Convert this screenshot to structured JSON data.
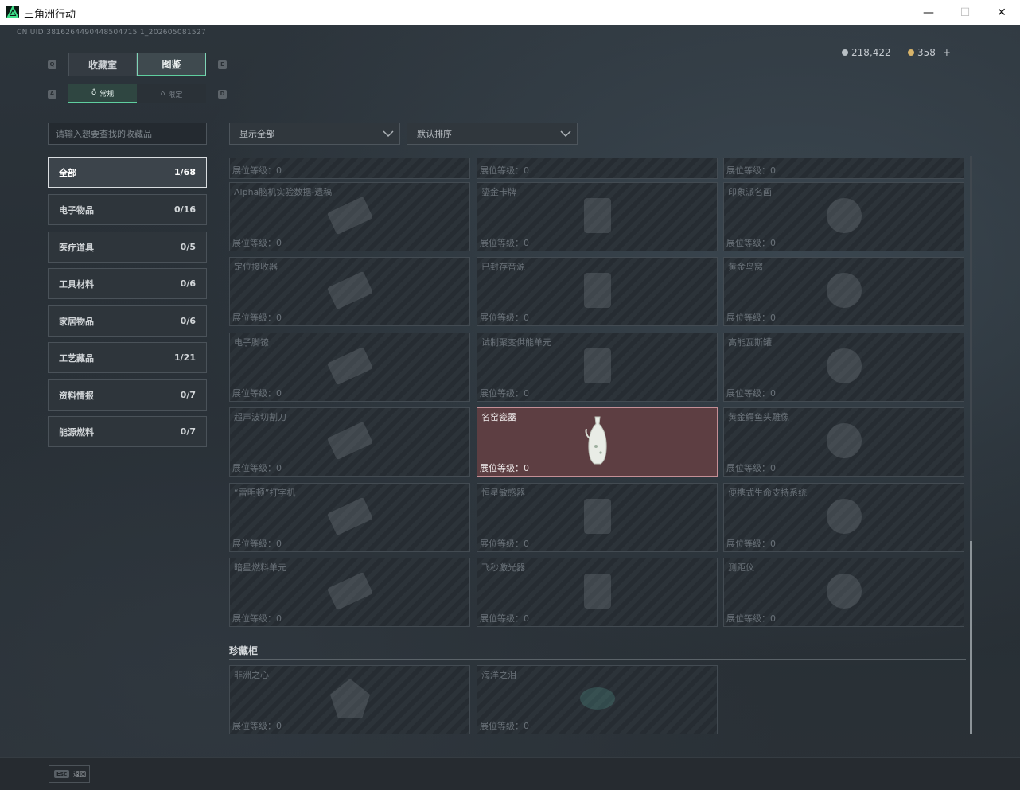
{
  "window": {
    "title": "三角洲行动"
  },
  "uid_text": "CN UID:3816264490448504715 1_202605081527",
  "currency": {
    "coins": "218,422",
    "gems": "358",
    "add_symbol": "+"
  },
  "keys": {
    "tab_left": "Q",
    "tab_right": "E",
    "subtab_left": "A",
    "subtab_right": "D"
  },
  "tabs": {
    "collection": "收藏室",
    "atlas": "图鉴"
  },
  "subtabs": {
    "regular": "常规",
    "limited": "限定"
  },
  "search": {
    "placeholder": "请输入想要查找的收藏品"
  },
  "dropdowns": {
    "filter": "显示全部",
    "sort": "默认排序"
  },
  "categories": [
    {
      "label": "全部",
      "count": "1/68"
    },
    {
      "label": "电子物品",
      "count": "0/16"
    },
    {
      "label": "医疗道具",
      "count": "0/5"
    },
    {
      "label": "工具材料",
      "count": "0/6"
    },
    {
      "label": "家居物品",
      "count": "0/6"
    },
    {
      "label": "工艺藏品",
      "count": "1/21"
    },
    {
      "label": "资料情报",
      "count": "0/7"
    },
    {
      "label": "能源燃料",
      "count": "0/7"
    }
  ],
  "level_label": "展位等级：0",
  "items": [
    {
      "name": ""
    },
    {
      "name": ""
    },
    {
      "name": ""
    },
    {
      "name": "Alpha脑机实验数据-遗稿"
    },
    {
      "name": "鎏金卡牌"
    },
    {
      "name": "印象派名画"
    },
    {
      "name": "定位接收器"
    },
    {
      "name": "已封存音源"
    },
    {
      "name": "黄金鸟窝"
    },
    {
      "name": "电子脚镣"
    },
    {
      "name": "试制聚变供能单元"
    },
    {
      "name": "高能瓦斯罐"
    },
    {
      "name": "超声波切割刀"
    },
    {
      "name": "名窑瓷器"
    },
    {
      "name": "黄金鳄鱼头雕像"
    },
    {
      "name": "“雷明顿”打字机"
    },
    {
      "name": "恒星敏感器"
    },
    {
      "name": "便携式生命支持系统"
    },
    {
      "name": "暗星燃料单元"
    },
    {
      "name": "飞秒激光器"
    },
    {
      "name": "测距仪"
    }
  ],
  "section": {
    "title": "珍藏柜"
  },
  "cabinet_items": [
    {
      "name": "非洲之心"
    },
    {
      "name": "海洋之泪"
    }
  ],
  "footer": {
    "esc_key": "Esc",
    "back_label": "返回"
  },
  "colors": {
    "accent": "#5fcf9f",
    "highlight_card": "#5d3e42",
    "background": "#2a3138"
  }
}
